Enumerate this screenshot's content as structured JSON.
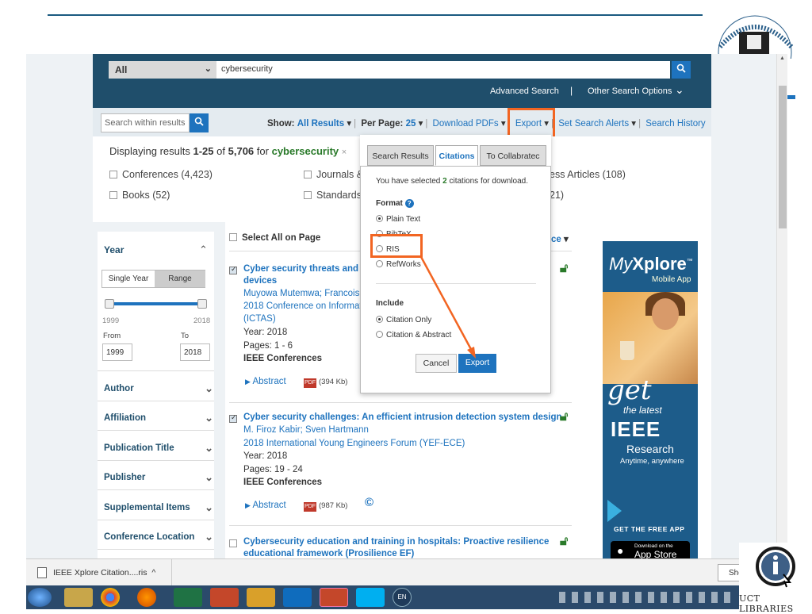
{
  "search": {
    "scope": "All",
    "query": "cybersecurity",
    "advanced": "Advanced Search",
    "separator": "|",
    "other": "Other Search Options"
  },
  "toolbar": {
    "within_placeholder": "Search within results",
    "show_label": "Show:",
    "show_value": "All Results",
    "per_page_label": "Per Page:",
    "per_page_value": "25",
    "download": "Download PDFs",
    "export": "Export",
    "alerts": "Set Search Alerts",
    "history": "Search History"
  },
  "results_summary": {
    "prefix": "Displaying results",
    "range": "1-25",
    "of": "of",
    "total": "5,706",
    "for": "for",
    "keyword": "cybersecurity",
    "clear": "×"
  },
  "facets": {
    "conferences": "Conferences (4,423)",
    "journals": "Journals &",
    "early_access": "ess Articles (108)",
    "books": "Books (52)",
    "standards": "Standards",
    "other_count": "21)"
  },
  "sidebar": {
    "year_title": "Year",
    "single_year": "Single Year",
    "range": "Range",
    "min": "1999",
    "max": "2018",
    "from_label": "From",
    "to_label": "To",
    "from_value": "1999",
    "to_value": "2018",
    "items": [
      "Author",
      "Affiliation",
      "Publication Title",
      "Publisher",
      "Supplemental Items",
      "Conference Location"
    ]
  },
  "select_all": "Select All on Page",
  "sort_partial": "ce",
  "results": [
    {
      "title_l1": "Cyber security threats and",
      "title_l2": "devices",
      "authors": "Muyowa Mutemwa; Francois",
      "venue_l1": "2018 Conference on Informat",
      "venue_l2": "(ICTAS)",
      "year": "Year: 2018",
      "pages": "Pages: 1 - 6",
      "publisher": "IEEE Conferences",
      "abstract": "Abstract",
      "pdf_size": "(394 Kb)"
    },
    {
      "title_l1": "Cyber security challenges: An efficient intrusion detection system design",
      "authors": "M. Firoz Kabir; Sven Hartmann",
      "venue_l1": "2018 International Young Engineers Forum (YEF-ECE)",
      "year": "Year: 2018",
      "pages": "Pages: 19 - 24",
      "publisher": "IEEE Conferences",
      "abstract": "Abstract",
      "pdf_size": "(987 Kb)",
      "copyright": "©"
    },
    {
      "title_l1": "Cybersecurity education and training in hospitals: Proactive resilience",
      "title_l2": "educational framework (Prosilience EF)"
    }
  ],
  "modal": {
    "tabs": [
      "Search Results",
      "Citations",
      "To Collabratec"
    ],
    "selected_prefix": "You have selected",
    "selected_count": "2",
    "selected_suffix": "citations for download.",
    "format_label": "Format",
    "formats": [
      "Plain Text",
      "BibTeX",
      "RIS",
      "RefWorks"
    ],
    "include_label": "Include",
    "includes": [
      "Citation Only",
      "Citation & Abstract"
    ],
    "cancel": "Cancel",
    "export": "Export"
  },
  "ad": {
    "title_my": "My",
    "title_xplore": "Xplore",
    "tm": "™",
    "mobile": "Mobile App",
    "get": "get",
    "latest": "the latest",
    "ieee": "IEEE",
    "research": "Research",
    "anytime": "Anytime, anywhere",
    "free": "GET THE FREE APP",
    "dl": "Download on the",
    "store": "App Store"
  },
  "download_bar": {
    "file": "IEEE Xplore Citation....ris",
    "caret": "^",
    "show": "Sho"
  },
  "branding": {
    "uct": "UCT LIBRARIES"
  },
  "taskbar": {
    "lang": "EN"
  }
}
